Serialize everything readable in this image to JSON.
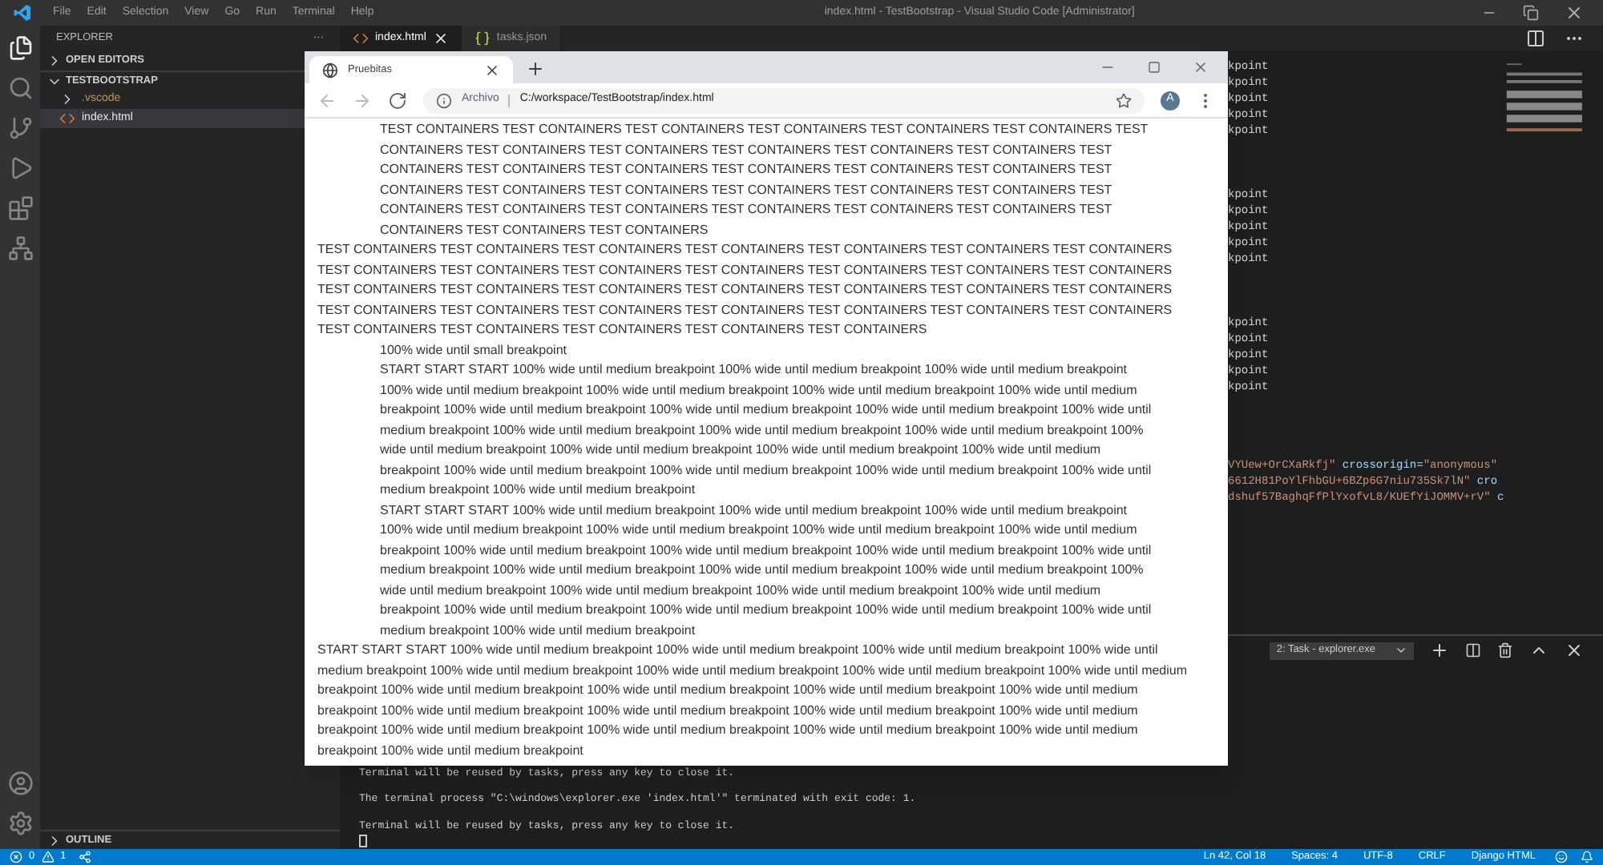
{
  "vscode": {
    "menu": [
      "File",
      "Edit",
      "Selection",
      "View",
      "Go",
      "Run",
      "Terminal",
      "Help"
    ],
    "title": "index.html - TestBootstrap - Visual Studio Code [Administrator]",
    "sidebar": {
      "header": "EXPLORER",
      "more": "···",
      "sections": [
        {
          "label": "OPEN EDITORS",
          "expanded": false
        },
        {
          "label": "TESTBOOTSTRAP",
          "expanded": true,
          "children": [
            {
              "label": ".vscode",
              "kind": "folder",
              "expanded": false,
              "selected": false
            },
            {
              "label": "index.html",
              "kind": "file",
              "selected": true
            }
          ]
        }
      ],
      "outline": {
        "label": "OUTLINE",
        "expanded": false
      }
    },
    "editor_tabs": [
      {
        "label": "index.html",
        "kind": "html",
        "selected": true
      },
      {
        "label": "tasks.json",
        "kind": "json",
        "selected": false
      }
    ],
    "code_blocks": [
      [
        [
          {
            "text": "kpoint",
            "kind": "text"
          }
        ],
        [
          {
            "text": "kpoint",
            "kind": "text"
          }
        ],
        [
          {
            "text": "kpoint",
            "kind": "text"
          }
        ],
        [
          {
            "text": "kpoint",
            "kind": "text"
          }
        ],
        [
          {
            "text": "kpoint",
            "kind": "text"
          }
        ]
      ],
      [
        [
          {
            "text": "kpoint",
            "kind": "text"
          }
        ],
        [
          {
            "text": "kpoint",
            "kind": "text"
          }
        ],
        [
          {
            "text": "kpoint",
            "kind": "text"
          }
        ],
        [
          {
            "text": "kpoint",
            "kind": "text"
          }
        ],
        [
          {
            "text": "kpoint",
            "kind": "text"
          }
        ]
      ],
      [
        [
          {
            "text": "kpoint",
            "kind": "text"
          }
        ],
        [
          {
            "text": "kpoint",
            "kind": "text"
          }
        ],
        [
          {
            "text": "kpoint",
            "kind": "text"
          }
        ],
        [
          {
            "text": "kpoint",
            "kind": "text"
          }
        ],
        [
          {
            "text": "kpoint",
            "kind": "text"
          }
        ]
      ],
      [
        [
          {
            "text": "VYUew+OrCXaRkfj\"",
            "kind": "string"
          },
          {
            "text": " crossorigin=",
            "kind": "attr"
          },
          {
            "text": "\"anonymous\"",
            "kind": "string"
          }
        ],
        [
          {
            "text": "6612H81PoYlFhbGU+6BZp6G7niu735Sk7lN\"",
            "kind": "string"
          },
          {
            "text": " cro",
            "kind": "attr"
          }
        ],
        [
          {
            "text": "dshuf57BaghqFfPlYxofvL8/KUEfYiJOMMV+rV\"",
            "kind": "string"
          },
          {
            "text": " c",
            "kind": "attr"
          }
        ]
      ]
    ],
    "panel": {
      "terminal_select": "2: Task - explorer.exe",
      "lines": [
        "Terminal will be reused by tasks, press any key to close it.",
        "The terminal process \"C:\\windows\\explorer.exe 'index.html'\" terminated with exit code: 1.",
        "Terminal will be reused by tasks, press any key to close it."
      ]
    },
    "status_bar": {
      "errors": "0",
      "warnings": "1",
      "items": [
        "Ln 42, Col 18",
        "Spaces: 4",
        "UTF-8",
        "CRLF",
        "Django HTML"
      ]
    }
  },
  "browser": {
    "tab": {
      "title": "Pruebitas",
      "selected": true
    },
    "address": {
      "scheme_label": "Archivo",
      "url": "C:/workspace/TestBootstrap/index.html"
    },
    "avatar": "A",
    "paragraphs": [
      {
        "indented": true,
        "text": "TEST CONTAINERS TEST CONTAINERS TEST CONTAINERS TEST CONTAINERS TEST CONTAINERS TEST CONTAINERS TEST CONTAINERS TEST CONTAINERS TEST CONTAINERS TEST CONTAINERS TEST CONTAINERS TEST CONTAINERS TEST CONTAINERS TEST CONTAINERS TEST CONTAINERS TEST CONTAINERS TEST CONTAINERS TEST CONTAINERS TEST CONTAINERS TEST CONTAINERS TEST CONTAINERS TEST CONTAINERS TEST CONTAINERS TEST CONTAINERS TEST CONTAINERS TEST CONTAINERS TEST CONTAINERS TEST CONTAINERS TEST CONTAINERS TEST CONTAINERS TEST CONTAINERS TEST CONTAINERS TEST CONTAINERS"
      },
      {
        "indented": false,
        "text": "TEST CONTAINERS TEST CONTAINERS TEST CONTAINERS TEST CONTAINERS TEST CONTAINERS TEST CONTAINERS TEST CONTAINERS TEST CONTAINERS TEST CONTAINERS TEST CONTAINERS TEST CONTAINERS TEST CONTAINERS TEST CONTAINERS TEST CONTAINERS TEST CONTAINERS TEST CONTAINERS TEST CONTAINERS TEST CONTAINERS TEST CONTAINERS TEST CONTAINERS TEST CONTAINERS TEST CONTAINERS TEST CONTAINERS TEST CONTAINERS TEST CONTAINERS TEST CONTAINERS TEST CONTAINERS TEST CONTAINERS TEST CONTAINERS TEST CONTAINERS TEST CONTAINERS TEST CONTAINERS TEST CONTAINERS"
      },
      {
        "indented": true,
        "text": "100% wide until small breakpoint"
      },
      {
        "indented": true,
        "text": "START START START 100% wide until medium breakpoint 100% wide until medium breakpoint 100% wide until medium breakpoint 100% wide until medium breakpoint 100% wide until medium breakpoint 100% wide until medium breakpoint 100% wide until medium breakpoint 100% wide until medium breakpoint 100% wide until medium breakpoint 100% wide until medium breakpoint 100% wide until medium breakpoint 100% wide until medium breakpoint 100% wide until medium breakpoint 100% wide until medium breakpoint 100% wide until medium breakpoint 100% wide until medium breakpoint 100% wide until medium breakpoint 100% wide until medium breakpoint 100% wide until medium breakpoint 100% wide until medium breakpoint 100% wide until medium breakpoint 100% wide until medium breakpoint 100% wide until medium breakpoint"
      },
      {
        "indented": true,
        "text": "START START START 100% wide until medium breakpoint 100% wide until medium breakpoint 100% wide until medium breakpoint 100% wide until medium breakpoint 100% wide until medium breakpoint 100% wide until medium breakpoint 100% wide until medium breakpoint 100% wide until medium breakpoint 100% wide until medium breakpoint 100% wide until medium breakpoint 100% wide until medium breakpoint 100% wide until medium breakpoint 100% wide until medium breakpoint 100% wide until medium breakpoint 100% wide until medium breakpoint 100% wide until medium breakpoint 100% wide until medium breakpoint 100% wide until medium breakpoint 100% wide until medium breakpoint 100% wide until medium breakpoint 100% wide until medium breakpoint 100% wide until medium breakpoint 100% wide until medium breakpoint"
      },
      {
        "indented": false,
        "text": "START START START 100% wide until medium breakpoint 100% wide until medium breakpoint 100% wide until medium breakpoint 100% wide until medium breakpoint 100% wide until medium breakpoint 100% wide until medium breakpoint 100% wide until medium breakpoint 100% wide until medium breakpoint 100% wide until medium breakpoint 100% wide until medium breakpoint 100% wide until medium breakpoint 100% wide until medium breakpoint 100% wide until medium breakpoint 100% wide until medium breakpoint 100% wide until medium breakpoint 100% wide until medium breakpoint 100% wide until medium breakpoint 100% wide until medium breakpoint 100% wide until medium breakpoint 100% wide until medium breakpoint 100% wide until medium breakpoint"
      }
    ]
  }
}
